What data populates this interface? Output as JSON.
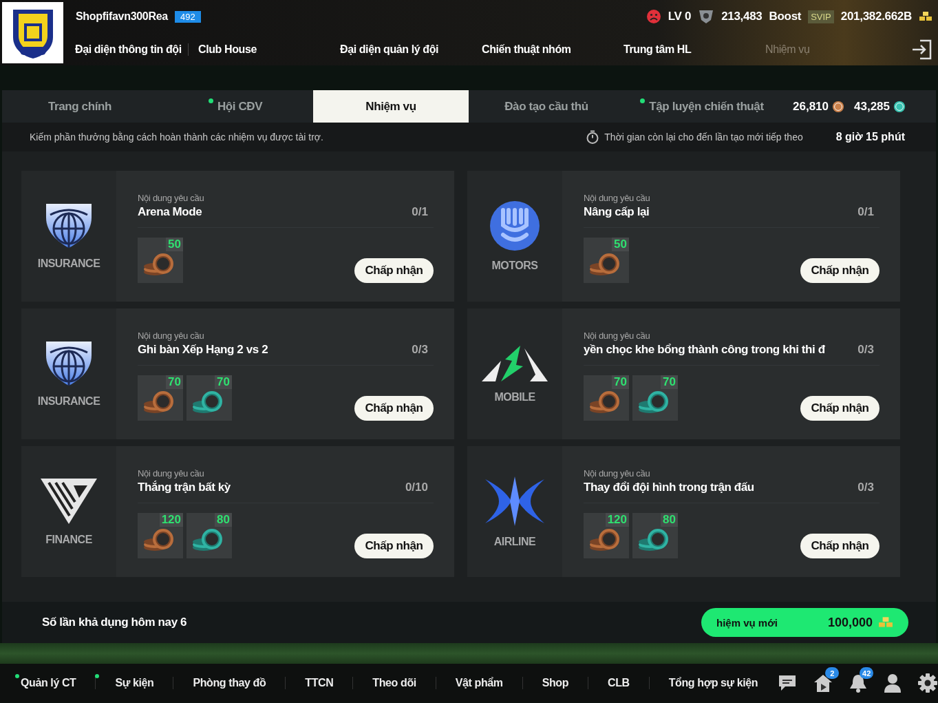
{
  "header": {
    "club_name": "Shopfifavn300Rea",
    "club_rating": "492",
    "level": "LV 0",
    "points": "213,483",
    "boost_label": "Boost",
    "vip_badge": "SVIP",
    "balance": "201,382.662B",
    "nav": [
      {
        "label": "Đại diện thông tin đội",
        "faded": false
      },
      {
        "label": "Club House",
        "faded": false
      },
      {
        "label": "Đại diện quản lý đội",
        "faded": false
      },
      {
        "label": "Chiến thuật nhóm",
        "faded": false
      },
      {
        "label": "Trung tâm HL",
        "faded": false
      },
      {
        "label": "Nhiệm vụ",
        "faded": true
      }
    ]
  },
  "tabs": [
    {
      "label": "Trang chính",
      "selected": false,
      "dot": false
    },
    {
      "label": "Hội CĐV",
      "selected": false,
      "dot": true
    },
    {
      "label": "Nhiệm vụ",
      "selected": true,
      "dot": false
    },
    {
      "label": "Đào tạo cầu thủ",
      "selected": false,
      "dot": false
    },
    {
      "label": "Tập luyện chiến thuật",
      "selected": false,
      "dot": true
    }
  ],
  "currencies": [
    {
      "kind": "sc",
      "amount": "26,810"
    },
    {
      "kind": "tc",
      "amount": "43,285"
    }
  ],
  "info": {
    "description": "Kiếm phần thưởng bằng cách hoàn thành các nhiệm vụ được tài trợ.",
    "timer_label": "Thời gian còn lại cho đến lần tạo mới tiếp theo",
    "timer_value": "8 giờ 15 phút"
  },
  "missions": [
    {
      "kind": "insurance",
      "sponsor": "INSURANCE",
      "requirement_label": "Nội dung yêu cầu",
      "title": "Arena Mode",
      "progress": "0/1",
      "rewards": [
        {
          "kind": "sc",
          "amount": "50"
        }
      ],
      "button": "Chấp nhận"
    },
    {
      "kind": "motors",
      "sponsor": "MOTORS",
      "requirement_label": "Nội dung yêu cầu",
      "title": "Nâng cấp lại",
      "progress": "0/1",
      "rewards": [
        {
          "kind": "sc",
          "amount": "50"
        }
      ],
      "button": "Chấp nhận"
    },
    {
      "kind": "insurance",
      "sponsor": "INSURANCE",
      "requirement_label": "Nội dung yêu cầu",
      "title": "Ghi bàn Xếp Hạng 2 vs 2",
      "progress": "0/3",
      "rewards": [
        {
          "kind": "sc",
          "amount": "70"
        },
        {
          "kind": "tc",
          "amount": "70"
        }
      ],
      "button": "Chấp nhận"
    },
    {
      "kind": "mobile",
      "sponsor": "MOBILE",
      "requirement_label": "Nội dung yêu cầu",
      "title": "yền chọc khe bổng thành công trong khi thi đ",
      "progress": "0/3",
      "rewards": [
        {
          "kind": "sc",
          "amount": "70"
        },
        {
          "kind": "tc",
          "amount": "70"
        }
      ],
      "button": "Chấp nhận"
    },
    {
      "kind": "finance",
      "sponsor": "FINANCE",
      "requirement_label": "Nội dung yêu cầu",
      "title": "Thắng trận bất kỳ",
      "progress": "0/10",
      "rewards": [
        {
          "kind": "sc",
          "amount": "120"
        },
        {
          "kind": "tc",
          "amount": "80"
        }
      ],
      "button": "Chấp nhận"
    },
    {
      "kind": "airline",
      "sponsor": "AIRLINE",
      "requirement_label": "Nội dung yêu cầu",
      "title": "Thay đổi đội hình trong trận đấu",
      "progress": "0/3",
      "rewards": [
        {
          "kind": "sc",
          "amount": "120"
        },
        {
          "kind": "tc",
          "amount": "80"
        }
      ],
      "button": "Chấp nhận"
    }
  ],
  "footer": {
    "available_today": "Số lần khả dụng hôm nay 6",
    "new_mission_button": "hiệm vụ mới",
    "new_mission_cost": "100,000"
  },
  "bottom_nav": [
    {
      "label": "Quản lý CT",
      "dot": true
    },
    {
      "label": "Sự kiện",
      "dot": true
    },
    {
      "label": "Phòng thay đồ",
      "dot": false
    },
    {
      "label": "TTCN",
      "dot": false
    },
    {
      "label": "Theo dõi",
      "dot": false
    },
    {
      "label": "Vật phẩm",
      "dot": false
    },
    {
      "label": "Shop",
      "dot": false
    },
    {
      "label": "CLB",
      "dot": false
    },
    {
      "label": "Tổng hợp sự kiện",
      "dot": false
    }
  ],
  "bottom_icons": [
    {
      "kind": "chat"
    },
    {
      "kind": "home",
      "badge": "2"
    },
    {
      "kind": "bell",
      "badge": "42"
    },
    {
      "kind": "profile"
    },
    {
      "kind": "settings"
    }
  ]
}
